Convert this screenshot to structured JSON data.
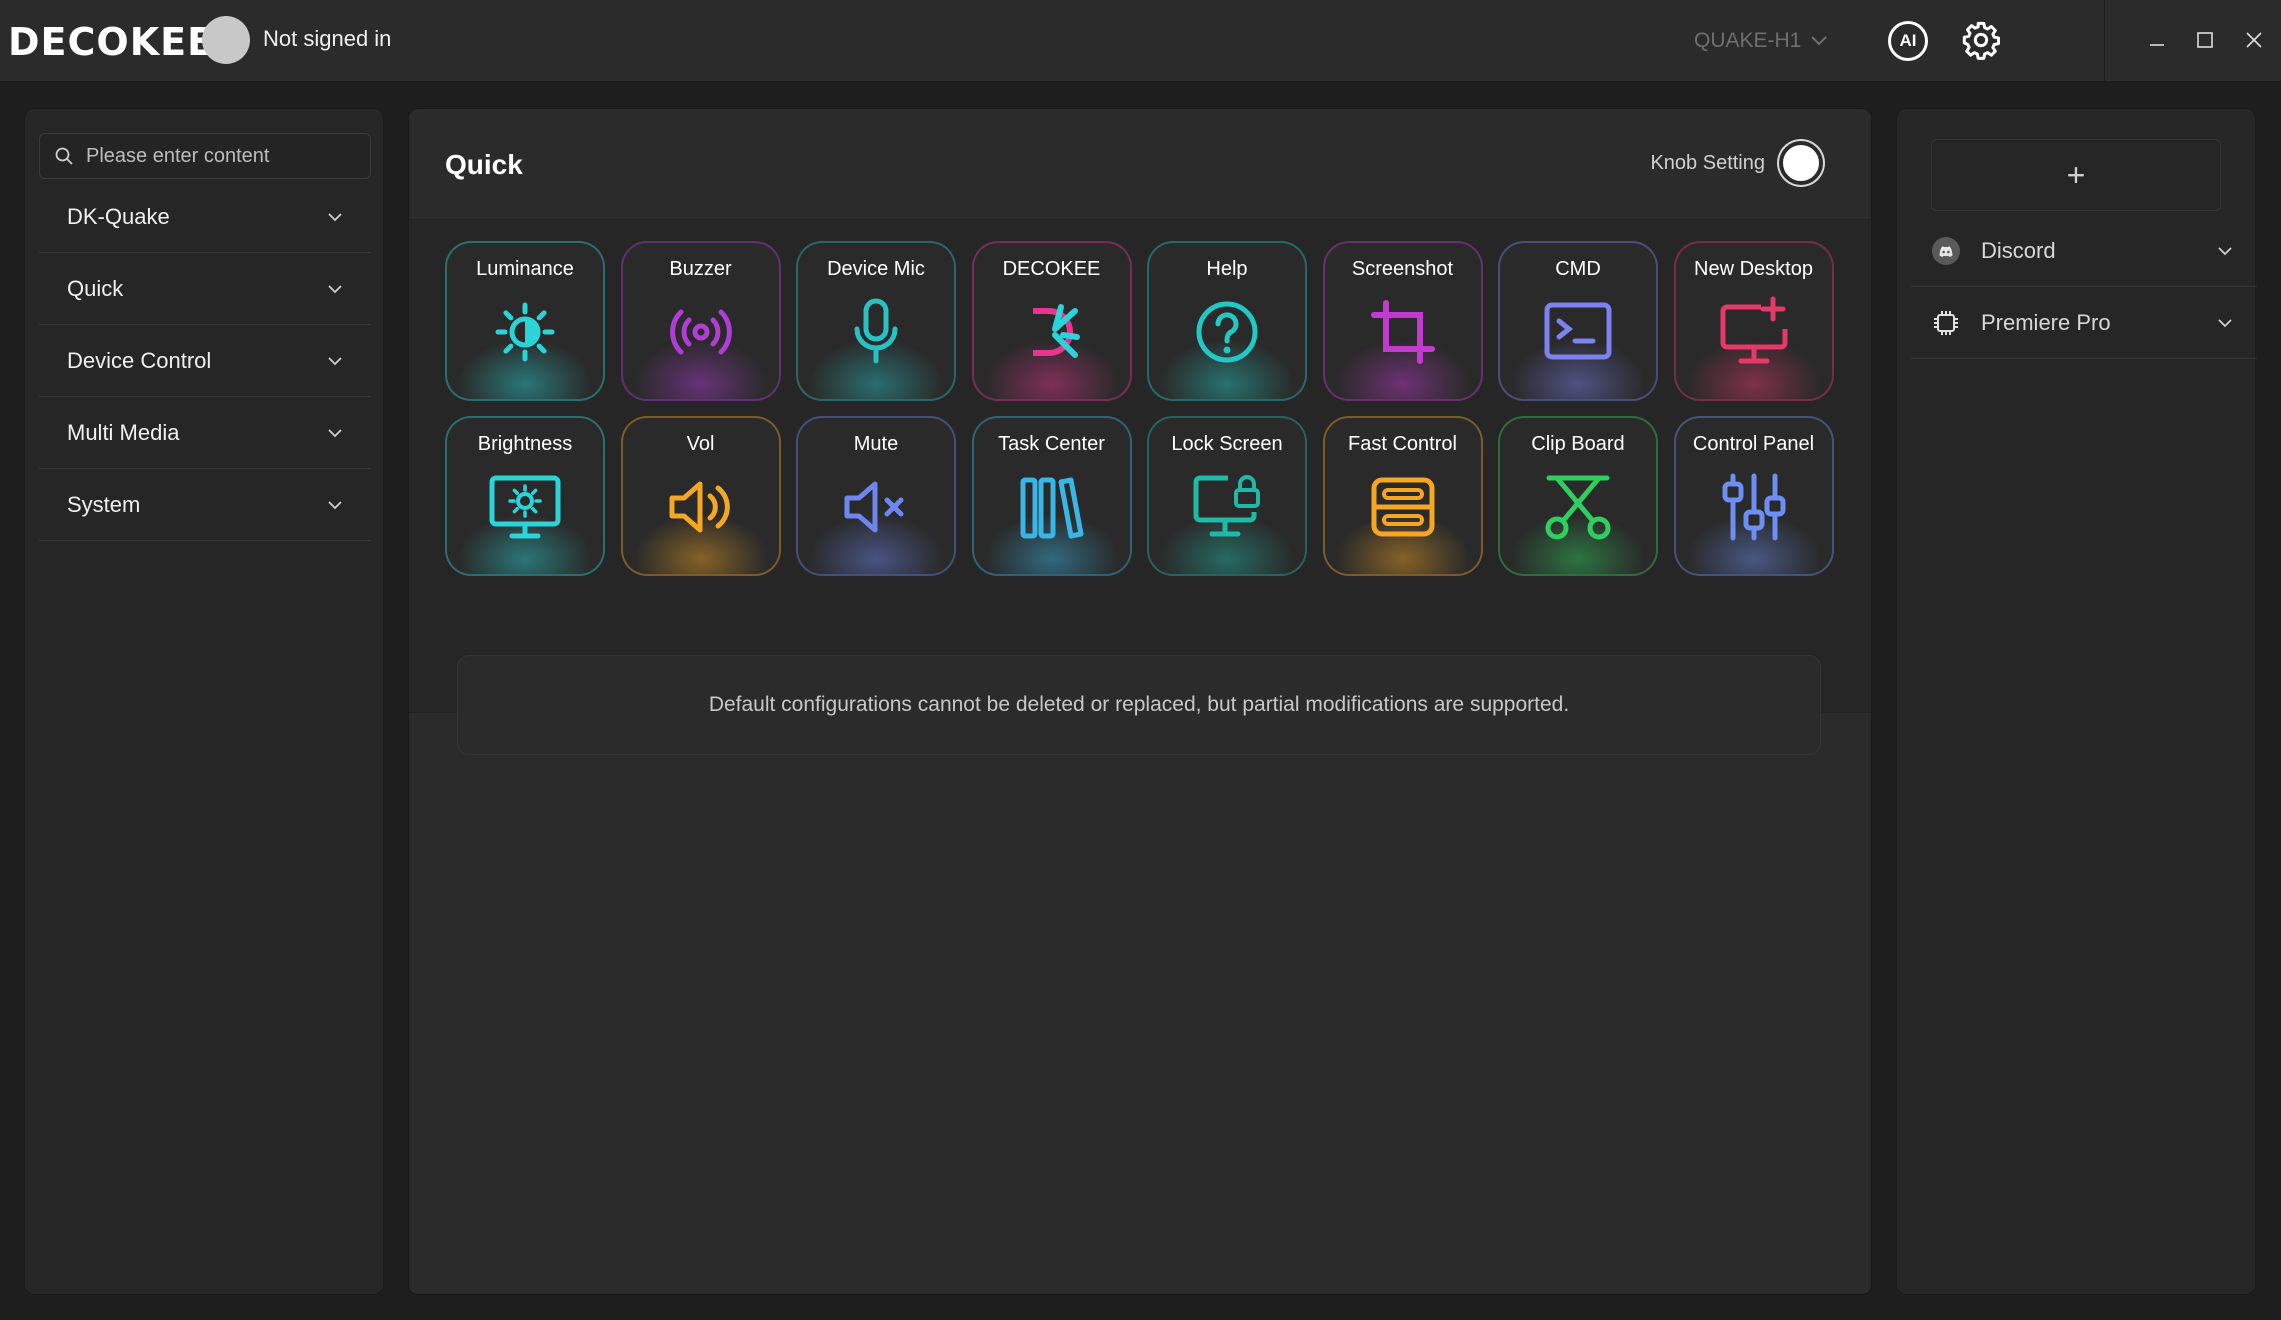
{
  "header": {
    "logo_text": "DECOKEE",
    "user_status": "Not signed in",
    "device": "QUAKE-H1",
    "ai_label": "AI"
  },
  "search": {
    "placeholder": "Please enter content"
  },
  "categories": [
    {
      "label": "DK-Quake"
    },
    {
      "label": "Quick"
    },
    {
      "label": "Device Control"
    },
    {
      "label": "Multi Media"
    },
    {
      "label": "System"
    }
  ],
  "main": {
    "title": "Quick",
    "knob_label": "Knob Setting",
    "notice": "Default configurations cannot be deleted or replaced, but partial modifications are supported.",
    "tiles": [
      {
        "label": "Luminance",
        "icon": "sun-icon",
        "color": "#2ad4d8"
      },
      {
        "label": "Buzzer",
        "icon": "broadcast-icon",
        "color": "#b13cd6"
      },
      {
        "label": "Device Mic",
        "icon": "microphone-icon",
        "color": "#2ac1c4"
      },
      {
        "label": "DECOKEE",
        "icon": "decokee-logo-icon",
        "color": "#e8358f"
      },
      {
        "label": "Help",
        "icon": "help-icon",
        "color": "#22c9c4"
      },
      {
        "label": "Screenshot",
        "icon": "crop-icon",
        "color": "#c23ad0"
      },
      {
        "label": "CMD",
        "icon": "terminal-icon",
        "color": "#7c82f0"
      },
      {
        "label": "New Desktop",
        "icon": "new-desktop-icon",
        "color": "#e7386a"
      },
      {
        "label": "Brightness",
        "icon": "monitor-brightness-icon",
        "color": "#2ad4d8"
      },
      {
        "label": "Vol",
        "icon": "volume-icon",
        "color": "#f5a623"
      },
      {
        "label": "Mute",
        "icon": "mute-icon",
        "color": "#6d86f0"
      },
      {
        "label": "Task Center",
        "icon": "task-center-icon",
        "color": "#3ab6e6"
      },
      {
        "label": "Lock Screen",
        "icon": "lock-screen-icon",
        "color": "#1fb9a8"
      },
      {
        "label": "Fast Control",
        "icon": "fast-control-icon",
        "color": "#f5a623"
      },
      {
        "label": "Clip Board",
        "icon": "scissors-icon",
        "color": "#2fcf5f"
      },
      {
        "label": "Control Panel",
        "icon": "sliders-icon",
        "color": "#6d8ef2"
      }
    ]
  },
  "apps": [
    {
      "label": "Discord",
      "icon": "discord-icon"
    },
    {
      "label": "Premiere Pro",
      "icon": "chip-icon"
    }
  ],
  "add_symbol": "+"
}
